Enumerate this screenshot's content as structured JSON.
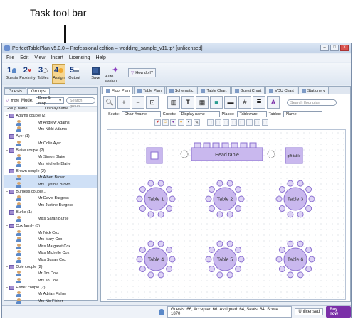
{
  "callout": {
    "text": "Task tool bar"
  },
  "window": {
    "title": "PerfectTablePlan v5.0.0 – Professional edition – wedding_sample_v11.tp* [unlicensed]"
  },
  "menu": [
    "File",
    "Edit",
    "View",
    "Insert",
    "Licensing",
    "Help"
  ],
  "toolbar": [
    {
      "num": "1",
      "label": "Guests",
      "icon": "guests-icon"
    },
    {
      "num": "2",
      "label": "Proximity",
      "icon": "heart-icon"
    },
    {
      "num": "3",
      "label": "Tables",
      "icon": "tables-icon"
    },
    {
      "num": "4",
      "label": "Assign",
      "icon": "assign-icon"
    },
    {
      "num": "5",
      "label": "Output",
      "icon": "printer-icon"
    },
    {
      "label": "Save",
      "icon": "save-icon"
    },
    {
      "label": "Auto assign",
      "icon": "magic-wand-icon"
    }
  ],
  "howdo": "How do I?",
  "left": {
    "tabs": [
      "Guests",
      "Groups"
    ],
    "more": "more",
    "mode_label": "Mode:",
    "mode_value": "Drag & drop",
    "search_placeholder": "Search group",
    "col1": "Group name",
    "col2": "Display name",
    "groups": [
      {
        "name": "Adams couple (2)",
        "members": [
          "Mr Andrew Adams",
          "Mrs Nikki Adams"
        ]
      },
      {
        "name": "Ayer (1)",
        "members": [
          "Mr Colin Ayer"
        ]
      },
      {
        "name": "Blaire couple (2)",
        "members": [
          "Mr Simon Blaire",
          "Mrs Michelle Blaire"
        ]
      },
      {
        "name": "Brown couple (2)",
        "members": [
          "Mr Albert Brown",
          "Mrs Cynthia Brown"
        ]
      },
      {
        "name": "Burgess couple...",
        "members": [
          "Mr David Burgess",
          "Mrs Justine Burgess"
        ]
      },
      {
        "name": "Burke (1)",
        "members": [
          "Miss Sarah Burke"
        ]
      },
      {
        "name": "Cox family (5)",
        "members": [
          "Mr Nick Cox",
          "Mrs Mary Cox",
          "Miss Margaret Cox",
          "Miss Michelle Cox",
          "Miss Susan Cox"
        ]
      },
      {
        "name": "Dole couple (2)",
        "members": [
          "Mr Jim Dole",
          "Mrs Jo Dole"
        ]
      },
      {
        "name": "Fisher couple (2)",
        "members": [
          "Mr Adrian Fisher",
          "Mrs Nic Fisher"
        ]
      }
    ]
  },
  "right": {
    "tabs": [
      "Floor Plan",
      "Table Plan",
      "Schematic",
      "Table Chart",
      "Guest Chart",
      "VDU Chart",
      "Stationery"
    ],
    "search_placeholder": "Search floor plan",
    "selectors": [
      {
        "label": "Seats:",
        "value": "Chair #name"
      },
      {
        "label": "Guests:",
        "value": "Display name"
      },
      {
        "label": "Places:",
        "value": "Tableware"
      },
      {
        "label": "Tables:",
        "value": "Name"
      }
    ],
    "head_table": "Head table",
    "gift_table": "gift table",
    "tables": [
      "Table 1",
      "Table 2",
      "Table 3",
      "Table 4",
      "Table 5",
      "Table 6"
    ]
  },
  "status": {
    "stats": "Guests: 66, Accepted 66, Assigned: 64, Seats: 64, Score 1870",
    "license": "Unlicensed",
    "buy": "Buy now"
  },
  "colors": {
    "accent": "#7b2fa8",
    "highlight": "#f6d690",
    "table_fill": "#c9b8ee",
    "table_stroke": "#8a6fd0"
  }
}
